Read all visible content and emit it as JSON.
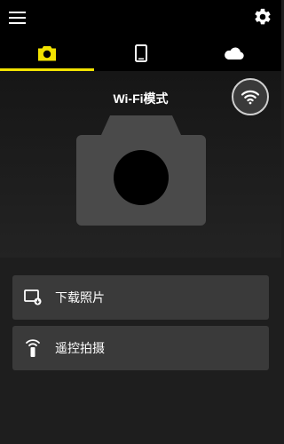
{
  "header": {
    "menu_icon": "hamburger-menu-icon",
    "settings_icon": "gear-icon"
  },
  "tabs": [
    {
      "icon": "camera-icon",
      "active": true
    },
    {
      "icon": "smartphone-icon",
      "active": false
    },
    {
      "icon": "cloud-icon",
      "active": false
    }
  ],
  "colors": {
    "accent": "#f2e200",
    "background": "#1e1e1e",
    "card": "#3a3a3a",
    "camera_graphic": "#4a4a4a"
  },
  "hero": {
    "mode_title": "Wi-Fi模式",
    "wifi_icon": "wifi-icon"
  },
  "actions": [
    {
      "label": "下载照片",
      "icon": "image-download-icon"
    },
    {
      "label": "遥控拍摄",
      "icon": "remote-control-icon"
    }
  ]
}
